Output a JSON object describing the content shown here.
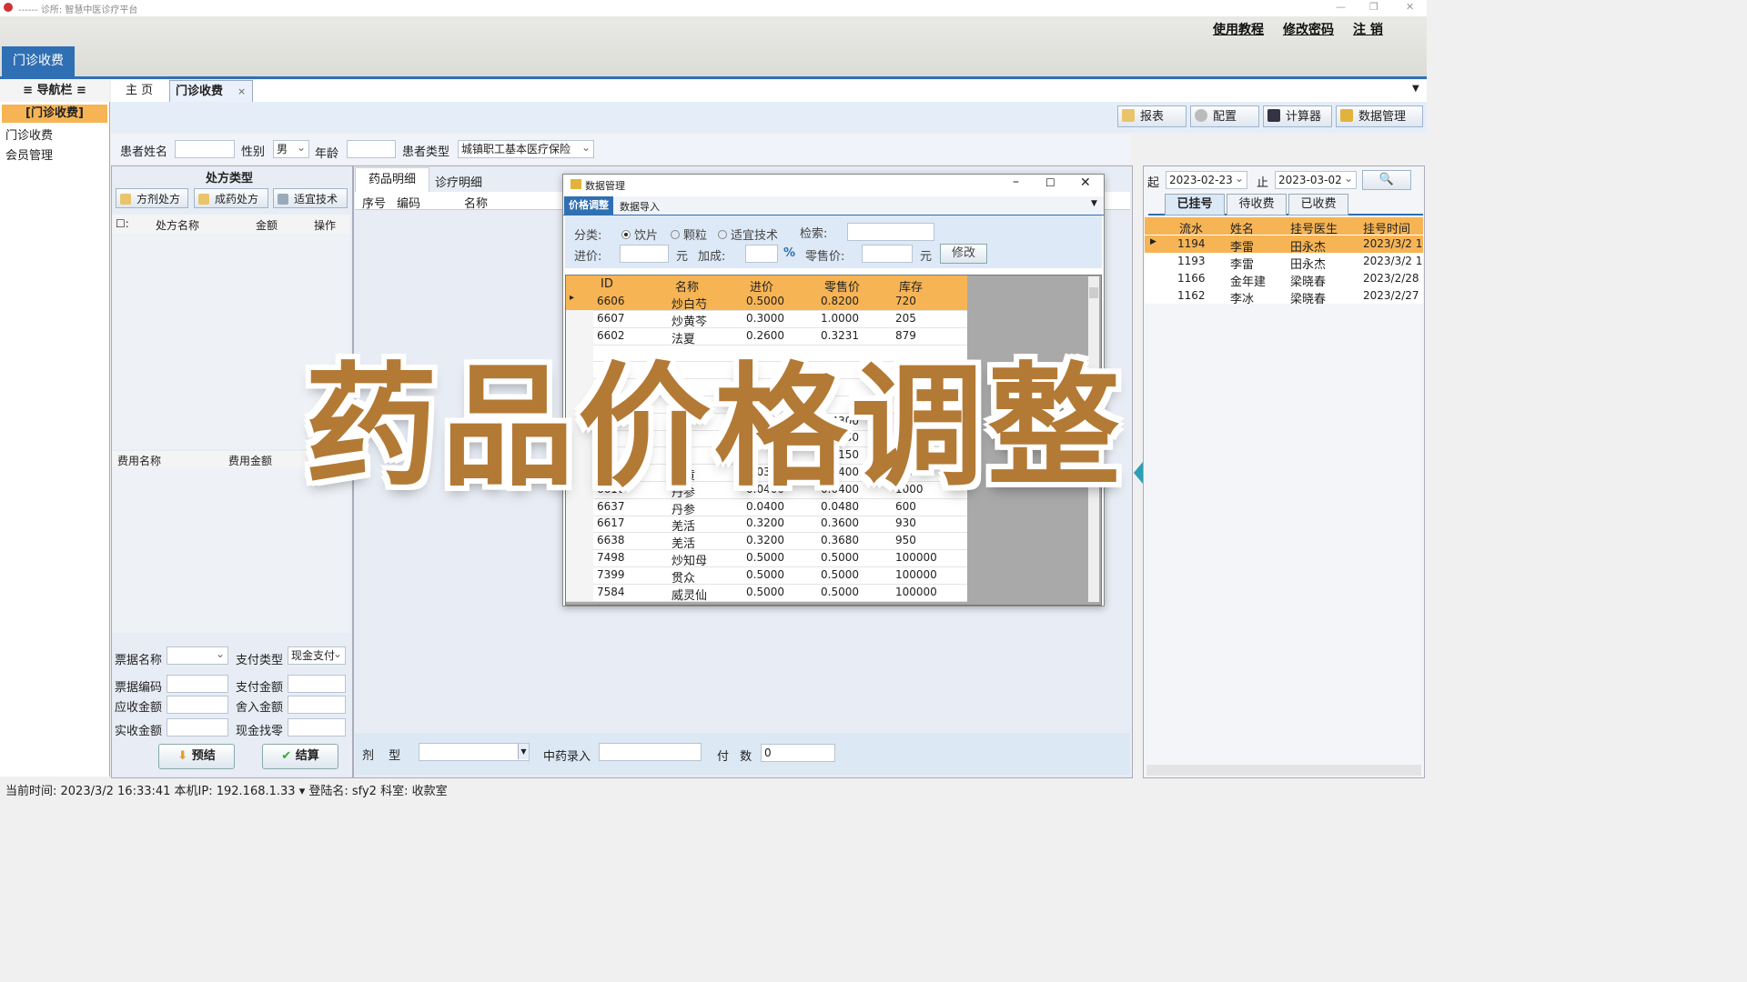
{
  "window": {
    "title": "------ 诊所: 智慧中医诊疗平台"
  },
  "banner": {
    "watermark": "",
    "links": [
      "使用教程",
      "修改密码",
      "注 销"
    ],
    "main_tab": "门诊收费"
  },
  "nav": {
    "header": "导航栏",
    "selected": "[门诊收费]",
    "items": [
      "门诊收费",
      "会员管理"
    ]
  },
  "page_tabs": [
    "主 页",
    "门诊收费"
  ],
  "toolbar": {
    "buttons": [
      "报表",
      "配置",
      "计算器",
      "数据管理"
    ]
  },
  "patient": {
    "name_label": "患者姓名",
    "name": "",
    "gender_label": "性别",
    "gender": "男",
    "age_label": "年龄",
    "age": "",
    "type_label": "患者类型",
    "type": "城镇职工基本医疗保险"
  },
  "prescription": {
    "title": "处方类型",
    "buttons": [
      "方剂处方",
      "成药处方",
      "适宜技术"
    ],
    "columns": [
      "☐:",
      "处方名称",
      "金额",
      "操作"
    ],
    "fee_columns": [
      "费用名称",
      "费用金额"
    ]
  },
  "billing": {
    "ticket_name_label": "票据名称",
    "ticket_name": "",
    "pay_type_label": "支付类型",
    "pay_type": "现金支付",
    "ticket_code_label": "票据编码",
    "pay_amount_label": "支付金额",
    "receivable_label": "应收金额",
    "roundoff_label": "舍入金额",
    "received_label": "实收金额",
    "change_label": "现金找零",
    "settle_pre": "预结",
    "settle": "结算"
  },
  "detail": {
    "tabs": [
      "药品明细",
      "诊疗明细"
    ],
    "columns": [
      "序号",
      "编码",
      "名称"
    ],
    "dosage_label": "剂 型",
    "dosage": "",
    "herb_input_label": "中药录入",
    "herb_input": "",
    "count_label": "付 数",
    "count": "0"
  },
  "right": {
    "from_label": "起",
    "from": "2023-02-23",
    "to_label": "止",
    "to": "2023-03-02",
    "tabs": [
      "已挂号",
      "待收费",
      "已收费"
    ],
    "columns": [
      "流水",
      "姓名",
      "挂号医生",
      "挂号时间"
    ],
    "rows": [
      {
        "id": "1194",
        "name": "李雷",
        "doctor": "田永杰",
        "time": "2023/3/2 1"
      },
      {
        "id": "1193",
        "name": "李雷",
        "doctor": "田永杰",
        "time": "2023/3/2 1"
      },
      {
        "id": "1166",
        "name": "金年建",
        "doctor": "梁晓春",
        "time": "2023/2/28"
      },
      {
        "id": "1162",
        "name": "李冰",
        "doctor": "梁晓春",
        "time": "2023/2/27"
      }
    ]
  },
  "dialog": {
    "title": "数据管理",
    "tabs": [
      "价格调整",
      "数据导入"
    ],
    "category_label": "分类:",
    "categories": [
      "饮片",
      "颗粒",
      "适宜技术"
    ],
    "search_label": "检索:",
    "cost_label": "进价:",
    "yuan": "元",
    "markup_label": "加成:",
    "percent": "%",
    "retail_label": "零售价:",
    "yuan2": "元",
    "modify": "修改",
    "columns": [
      "ID",
      "名称",
      "进价",
      "零售价",
      "库存"
    ],
    "rows": [
      {
        "id": "6606",
        "name": "炒白芍",
        "cost": "0.5000",
        "retail": "0.8200",
        "stock": "720"
      },
      {
        "id": "6607",
        "name": "炒黄芩",
        "cost": "0.3000",
        "retail": "1.0000",
        "stock": "205"
      },
      {
        "id": "6602",
        "name": "法夏",
        "cost": "0.2600",
        "retail": "0.3231",
        "stock": "879"
      },
      {
        "id": "",
        "name": "",
        "cost": "",
        "retail": "",
        "stock": ""
      },
      {
        "id": "",
        "name": "",
        "cost": "",
        "retail": "",
        "stock": ""
      },
      {
        "id": "",
        "name": "",
        "cost": "",
        "retail": "",
        "stock": ""
      },
      {
        "id": "",
        "name": "",
        "cost": "",
        "retail": "",
        "stock": ""
      },
      {
        "id": "",
        "name": "",
        "cost": "",
        "retail": "0.4300",
        "stock": ""
      },
      {
        "id": "",
        "name": "",
        "cost": "",
        "retail": "0.4450",
        "stock": ""
      },
      {
        "id": "",
        "name": "",
        "cost": "",
        "retail": "0.4150",
        "stock": ""
      },
      {
        "id": "6618",
        "name": "姜黄",
        "cost": "0.0300",
        "retail": "0.0400",
        "stock": "938"
      },
      {
        "id": "6616",
        "name": "丹参",
        "cost": "0.0400",
        "retail": "0.0400",
        "stock": "1000"
      },
      {
        "id": "6637",
        "name": "丹参",
        "cost": "0.0400",
        "retail": "0.0480",
        "stock": "600"
      },
      {
        "id": "6617",
        "name": "羌活",
        "cost": "0.3200",
        "retail": "0.3600",
        "stock": "930"
      },
      {
        "id": "6638",
        "name": "羌活",
        "cost": "0.3200",
        "retail": "0.3680",
        "stock": "950"
      },
      {
        "id": "7498",
        "name": "炒知母",
        "cost": "0.5000",
        "retail": "0.5000",
        "stock": "100000"
      },
      {
        "id": "7399",
        "name": "贯众",
        "cost": "0.5000",
        "retail": "0.5000",
        "stock": "100000"
      },
      {
        "id": "7584",
        "name": "威灵仙",
        "cost": "0.5000",
        "retail": "0.5000",
        "stock": "100000"
      }
    ]
  },
  "overlay_caption": "药品价格调整",
  "status": {
    "text": "当前时间: 2023/3/2 16:33:41 本机IP: 192.168.1.33 ▾ 登陆名: sfy2 科室: 收款室"
  }
}
